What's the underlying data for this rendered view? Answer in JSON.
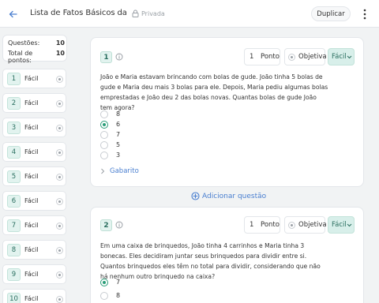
{
  "header": {
    "title": "Lista de Fatos Básicos da A...",
    "privacy_label": "Privada",
    "duplicate_label": "Duplicar"
  },
  "summary": {
    "questions_label": "Questões:",
    "questions_value": "10",
    "total_label": "Total de pontos:",
    "total_value": "10"
  },
  "sidebar": {
    "items": [
      {
        "num": "1",
        "difficulty": "Fácil"
      },
      {
        "num": "2",
        "difficulty": "Fácil"
      },
      {
        "num": "3",
        "difficulty": "Fácil"
      },
      {
        "num": "4",
        "difficulty": "Fácil"
      },
      {
        "num": "5",
        "difficulty": "Fácil"
      },
      {
        "num": "6",
        "difficulty": "Fácil"
      },
      {
        "num": "7",
        "difficulty": "Fácil"
      },
      {
        "num": "8",
        "difficulty": "Fácil"
      },
      {
        "num": "9",
        "difficulty": "Fácil"
      },
      {
        "num": "10",
        "difficulty": "Fácil"
      }
    ]
  },
  "questions": [
    {
      "num": "1",
      "points": "1",
      "points_label": "Ponto",
      "type": "Objetiva",
      "difficulty": "Fácil",
      "text": "João e Maria estavam brincando com bolas de gude. João tinha 5 bolas de gude e Maria deu mais 3 bolas para ele. Depois, Maria pediu algumas bolas emprestadas e João deu 2 das bolas novas. Quantas bolas de gude João tem agora?",
      "options": [
        "8",
        "6",
        "7",
        "5",
        "3"
      ],
      "selected_index": 1,
      "answer_key_label": "Gabarito"
    },
    {
      "num": "2",
      "points": "1",
      "points_label": "Ponto",
      "type": "Objetiva",
      "difficulty": "Fácil",
      "text": "Em uma caixa de brinquedos, João tinha 4 carrinhos e Maria tinha 3 bonecas. Eles decidiram juntar seus brinquedos para dividir entre si. Quantos brinquedos eles têm no total para dividir, considerando que não há nenhum outro brinquedo na caixa?",
      "options": [
        "7",
        "8"
      ],
      "selected_index": 0
    }
  ],
  "add_question_label": "Adicionar questão",
  "colors": {
    "accent_blue": "#4a7fd0",
    "accent_green": "#2a9d78",
    "badge_bg": "#e2f3ef"
  },
  "icons": [
    "back-arrow-icon",
    "lock-icon",
    "more-vertical-icon",
    "info-icon",
    "chevron-down-icon",
    "chevron-right-icon",
    "add-circle-icon"
  ]
}
